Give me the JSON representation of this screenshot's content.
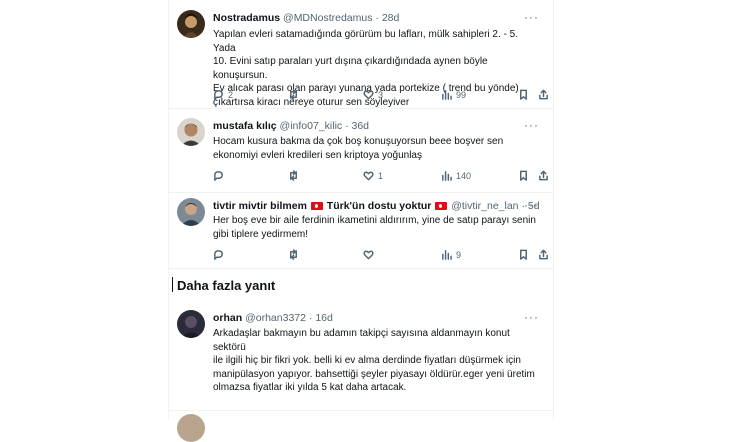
{
  "tweets": [
    {
      "name": "Nostradamus",
      "handle": "@MDNostredamus",
      "dot": "·",
      "time": "28d",
      "more": "···",
      "lines": [
        "Yapılan evleri satamadığında görürüm bu lafları, mülk sahipleri 2. - 5. Yada",
        "10. Evini satıp paraları yurt dışına çıkardığındada aynen böyle konuşursun.",
        "Ev alıcak parası olan parayı yunana yada portekize ( trend bu yönde)",
        "çıkartırsa kiracı nereye oturur sen söyleyiver"
      ],
      "replies": "2",
      "retweets": "",
      "likes": "3",
      "views": "99"
    },
    {
      "name": "mustafa kılıç",
      "handle": "@info07_kilic",
      "dot": "·",
      "time": "36d",
      "more": "···",
      "lines": [
        "Hocam kusura bakma da çok boş konuşuyorsun beee boşver sen",
        "ekonomiyi evleri kredileri sen kriptoya yoğunlaş"
      ],
      "replies": "",
      "retweets": "",
      "likes": "1",
      "views": "140"
    },
    {
      "name_a": "tivtir mivtir bilmem",
      "name_b": "Türk'ün dostu yoktur",
      "handle": "@tivtir_ne_lan",
      "dot": "·",
      "time": "5d",
      "more": "···",
      "lines": [
        "Her boş eve bir aile ferdinin ikametini aldırırım, yine de satıp parayı senin",
        "gibi tiplere yedirmem!"
      ],
      "replies": "",
      "retweets": "",
      "likes": "",
      "views": "9"
    },
    {
      "name": "orhan",
      "handle": "@orhan3372",
      "dot": "·",
      "time": "16d",
      "more": "···",
      "lines": [
        "Arkadaşlar bakmayın bu adamın takipçi sayısına aldanmayın konut sektörü",
        "ile ilgili hiç bir fikri yok. belli ki ev alma derdinde fiyatları düşürmek için",
        "manipülasyon yapıyor. bahsettiği şeyler piyasayı öldürür.eger yeni üretim",
        "olmazsa fiyatlar iki yılda 5 kat daha artacak."
      ],
      "replies": "",
      "retweets": "",
      "likes": "",
      "views": ""
    }
  ],
  "more_replies": "Daha fazla yanıt",
  "icons": [
    "reply-icon",
    "retweet-icon",
    "like-icon",
    "views-icon",
    "bookmark-icon",
    "share-icon"
  ],
  "colors": {
    "text": "#0f1419",
    "muted": "#536471",
    "divider": "#eff3f4",
    "flag": "#e30a17"
  }
}
